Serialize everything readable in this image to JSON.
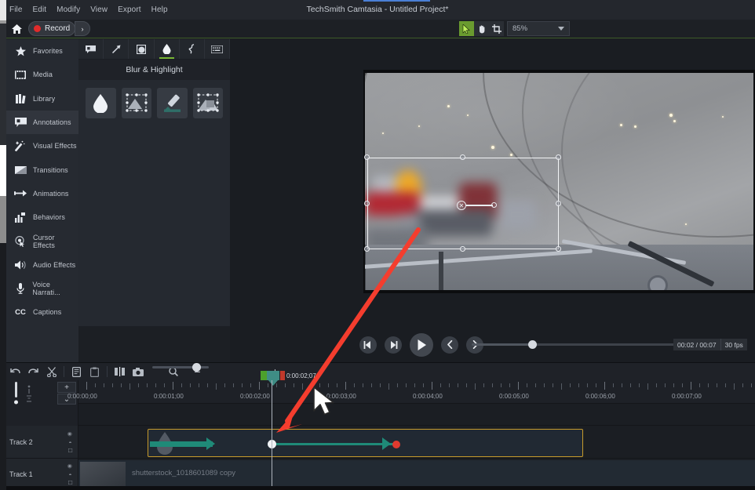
{
  "window": {
    "title": "TechSmith Camtasia - Untitled Project*"
  },
  "menubar": {
    "items": [
      {
        "label": "File"
      },
      {
        "label": "Edit"
      },
      {
        "label": "Modify"
      },
      {
        "label": "View"
      },
      {
        "label": "Export"
      },
      {
        "label": "Help"
      }
    ]
  },
  "toolbar": {
    "home_icon": "home-icon",
    "record_label": "Record",
    "record_caret": "›",
    "tools": [
      {
        "name": "select-tool",
        "icon": "cursor-arrow-icon",
        "active": true
      },
      {
        "name": "hand-tool",
        "icon": "hand-icon",
        "active": false
      },
      {
        "name": "crop-tool",
        "icon": "crop-icon",
        "active": false
      }
    ],
    "zoom_value": "85%"
  },
  "sidebar": {
    "items": [
      {
        "label": "Favorites",
        "icon": "star-icon",
        "active": false
      },
      {
        "label": "Media",
        "icon": "film-icon",
        "active": false
      },
      {
        "label": "Library",
        "icon": "books-icon",
        "active": false
      },
      {
        "label": "Annotations",
        "icon": "callout-icon",
        "active": true
      },
      {
        "label": "Visual Effects",
        "icon": "wand-icon",
        "active": false
      },
      {
        "label": "Transitions",
        "icon": "transition-icon",
        "active": false
      },
      {
        "label": "Animations",
        "icon": "animation-arrow-icon",
        "active": false
      },
      {
        "label": "Behaviors",
        "icon": "behaviors-icon",
        "active": false
      },
      {
        "label": "Cursor Effects",
        "icon": "cursor-effects-icon",
        "active": false
      },
      {
        "label": "Audio Effects",
        "icon": "speaker-icon",
        "active": false
      },
      {
        "label": "Voice Narrati...",
        "icon": "microphone-icon",
        "active": false
      },
      {
        "label": "Captions",
        "icon": "cc-icon",
        "active": false
      }
    ]
  },
  "panel": {
    "title": "Blur & Highlight",
    "tabs": [
      {
        "name": "callout-tab",
        "icon": "callout-bubble-icon",
        "active": false
      },
      {
        "name": "arrow-tab",
        "icon": "arrow-diagonal-icon",
        "active": false
      },
      {
        "name": "shape-tab",
        "icon": "shape-circle-icon",
        "active": false
      },
      {
        "name": "blur-highlight-tab",
        "icon": "water-drop-icon",
        "active": true
      },
      {
        "name": "sketch-motion-tab",
        "icon": "squiggle-icon",
        "active": false
      },
      {
        "name": "keystroke-tab",
        "icon": "keyboard-icon",
        "active": false
      }
    ],
    "presets": [
      {
        "name": "blur-preset",
        "icon": "water-drop-icon"
      },
      {
        "name": "blur-region-preset",
        "icon": "blur-region-icon"
      },
      {
        "name": "highlight-preset",
        "icon": "marker-pen-icon"
      },
      {
        "name": "pixelate-preset",
        "icon": "spotlight-region-icon"
      }
    ]
  },
  "playback": {
    "buttons": [
      {
        "name": "previous-frame-button",
        "icon": "step-back-icon"
      },
      {
        "name": "next-frame-button",
        "icon": "step-forward-icon"
      },
      {
        "name": "play-button",
        "icon": "play-icon"
      },
      {
        "name": "previous-marker-button",
        "icon": "chevron-left-icon"
      },
      {
        "name": "next-marker-button",
        "icon": "chevron-right-icon"
      }
    ],
    "time_display": "00:02 / 00:07",
    "fps_display": "30 fps"
  },
  "timeline_toolbar": {
    "buttons": [
      {
        "name": "undo-button",
        "icon": "undo-icon"
      },
      {
        "name": "redo-button",
        "icon": "redo-icon"
      },
      {
        "name": "cut-button",
        "icon": "scissors-icon"
      },
      {
        "name": "copy-button",
        "icon": "copy-icon"
      },
      {
        "name": "paste-button",
        "icon": "paste-icon"
      },
      {
        "name": "split-button",
        "icon": "split-icon"
      },
      {
        "name": "screenshot-button",
        "icon": "camera-icon"
      },
      {
        "name": "zoom-to-fit-button",
        "icon": "magnifier-icon"
      }
    ],
    "zoom_out_label": "−",
    "zoom_in_label": "+",
    "track_height_increase": "+",
    "track_height_menu": "⌄"
  },
  "timeline": {
    "ruler_labels": [
      "0:00:00;00",
      "0:00:01;00",
      "0:00:02;00",
      "0:00:03;00",
      "0:00:04;00",
      "0:00:05;00",
      "0:00:06;00",
      "0:00:07;00"
    ],
    "playhead_time": "0:00:02;07",
    "tracks": [
      {
        "name": "Track 2",
        "clip": {
          "name": "blur-annotation-clip",
          "label": "",
          "selected": true,
          "border_color": "#c79a2b"
        }
      },
      {
        "name": "Track 1",
        "clip": {
          "name": "media-clip",
          "label": "shutterstock_1018601089 copy",
          "selected": false
        }
      }
    ],
    "track_controls": [
      "eye-icon",
      "speaker-icon",
      "lock-icon"
    ]
  },
  "canvas": {
    "selection": {
      "name": "blur-selection-box",
      "handles": 8,
      "rotation_handle": "rotation-handle-icon"
    }
  },
  "colors": {
    "accent_green": "#78b634",
    "record_red": "#e02b2b",
    "clip_selection": "#c79a2b",
    "animation_teal": "#1f8a78",
    "annotation_arrow": "#f43d2e",
    "panel_bg": "#252930",
    "sidebar_bg": "#262a31"
  }
}
